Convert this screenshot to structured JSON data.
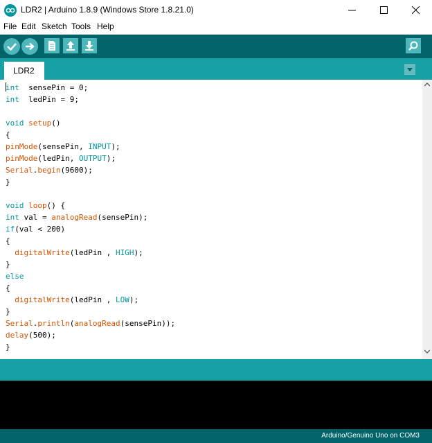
{
  "window": {
    "title": "LDR2 | Arduino 1.8.9 (Windows Store 1.8.21.0)"
  },
  "menu": [
    "File",
    "Edit",
    "Sketch",
    "Tools",
    "Help"
  ],
  "toolbar": {
    "buttons": [
      "verify-icon",
      "upload-icon",
      "new-icon",
      "open-icon",
      "save-icon"
    ],
    "serial_monitor": "serial-monitor-icon"
  },
  "tabs": [
    {
      "label": "LDR2",
      "active": true
    }
  ],
  "code": {
    "lines": [
      [
        [
          "kw",
          "int"
        ],
        [
          "",
          "  sensePin = 0;"
        ]
      ],
      [
        [
          "kw",
          "int"
        ],
        [
          "",
          "  ledPin = 9;"
        ]
      ],
      [],
      [
        [
          "kw",
          "void"
        ],
        [
          "",
          " "
        ],
        [
          "fn",
          "setup"
        ],
        [
          "",
          "()"
        ]
      ],
      [
        [
          "",
          "{"
        ]
      ],
      [
        [
          "fn",
          "pinMode"
        ],
        [
          "",
          "(sensePin, "
        ],
        [
          "const",
          "INPUT"
        ],
        [
          "",
          ");"
        ]
      ],
      [
        [
          "fn",
          "pinMode"
        ],
        [
          "",
          "(ledPin, "
        ],
        [
          "const",
          "OUTPUT"
        ],
        [
          "",
          ");"
        ]
      ],
      [
        [
          "fn",
          "Serial"
        ],
        [
          "",
          "."
        ],
        [
          "fn",
          "begin"
        ],
        [
          "",
          "(9600);"
        ]
      ],
      [
        [
          "",
          "}"
        ]
      ],
      [],
      [
        [
          "kw",
          "void"
        ],
        [
          "",
          " "
        ],
        [
          "fn",
          "loop"
        ],
        [
          "",
          "() {"
        ]
      ],
      [
        [
          "kw",
          "int"
        ],
        [
          "",
          " val = "
        ],
        [
          "fn",
          "analogRead"
        ],
        [
          "",
          "(sensePin);"
        ]
      ],
      [
        [
          "kw",
          "if"
        ],
        [
          "",
          "(val < 200)"
        ]
      ],
      [
        [
          "",
          "{"
        ]
      ],
      [
        [
          "",
          "  "
        ],
        [
          "fn",
          "digitalWrite"
        ],
        [
          "",
          "(ledPin , "
        ],
        [
          "const",
          "HIGH"
        ],
        [
          "",
          ");"
        ]
      ],
      [
        [
          "",
          "}"
        ]
      ],
      [
        [
          "kw",
          "else"
        ]
      ],
      [
        [
          "",
          "{"
        ]
      ],
      [
        [
          "",
          "  "
        ],
        [
          "fn",
          "digitalWrite"
        ],
        [
          "",
          "(ledPin , "
        ],
        [
          "const",
          "LOW"
        ],
        [
          "",
          ");"
        ]
      ],
      [
        [
          "",
          "}"
        ]
      ],
      [
        [
          "fn",
          "Serial"
        ],
        [
          "",
          "."
        ],
        [
          "fn",
          "println"
        ],
        [
          "",
          "("
        ],
        [
          "fn",
          "analogRead"
        ],
        [
          "",
          "(sensePin));"
        ]
      ],
      [
        [
          "fn",
          "delay"
        ],
        [
          "",
          "(500);"
        ]
      ],
      [
        [
          "",
          "}"
        ]
      ]
    ]
  },
  "status": {
    "board": "Arduino/Genuino Uno on COM3"
  },
  "colors": {
    "teal_dark": "#006468",
    "teal": "#17a1a5",
    "keyword": "#00979c",
    "function": "#d35400"
  }
}
